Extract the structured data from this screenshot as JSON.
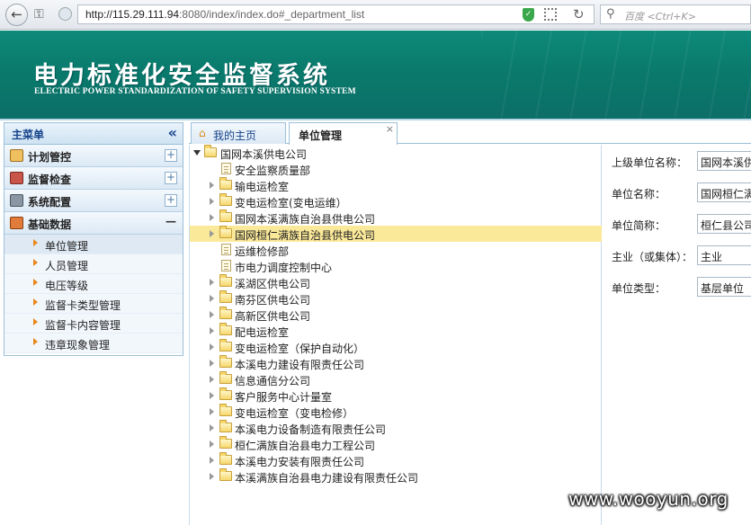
{
  "browser": {
    "url_host": "http://115.29.111.94",
    "url_rest": ":8080/index/index.do#_department_list",
    "search_placeholder": "百度 <Ctrl+K>"
  },
  "header": {
    "title": "电力标准化安全监督系统",
    "subtitle": "ELECTRIC POWER STANDARDIZATION OF SAFETY SUPERVISION SYSTEM"
  },
  "menu": {
    "title": "主菜单",
    "collapse_icon": "double-left-chevron-icon",
    "groups": [
      {
        "label": "计划管控",
        "icon": "clipboard-icon",
        "color": "#e8a33a"
      },
      {
        "label": "监督检查",
        "icon": "inspect-icon",
        "color": "#c0392b"
      },
      {
        "label": "系统配置",
        "icon": "config-icon",
        "color": "#7f8c8d"
      },
      {
        "label": "基础数据",
        "icon": "data-icon",
        "color": "#d35400"
      }
    ],
    "sub_items": [
      "单位管理",
      "人员管理",
      "电压等级",
      "监督卡类型管理",
      "监督卡内容管理",
      "违章现象管理"
    ]
  },
  "tabs": [
    {
      "label": "我的主页",
      "icon": "home-icon"
    },
    {
      "label": "单位管理",
      "close": "×"
    }
  ],
  "tree": {
    "root": "国网本溪供电公司",
    "nodes": [
      {
        "label": "安全监察质量部",
        "type": "doc"
      },
      {
        "label": "输电运检室",
        "type": "folder"
      },
      {
        "label": "变电运检室(变电运维）",
        "type": "folder"
      },
      {
        "label": "国网本溪满族自治县供电公司",
        "type": "folder"
      },
      {
        "label": "国网桓仁满族自治县供电公司",
        "type": "folder",
        "selected": true
      },
      {
        "label": "运维检修部",
        "type": "doc"
      },
      {
        "label": "市电力调度控制中心",
        "type": "doc"
      },
      {
        "label": "溪湖区供电公司",
        "type": "folder"
      },
      {
        "label": "南芬区供电公司",
        "type": "folder"
      },
      {
        "label": "高新区供电公司",
        "type": "folder"
      },
      {
        "label": "配电运检室",
        "type": "folder"
      },
      {
        "label": "变电运检室（保护自动化）",
        "type": "folder"
      },
      {
        "label": "本溪电力建设有限责任公司",
        "type": "folder"
      },
      {
        "label": "信息通信分公司",
        "type": "folder"
      },
      {
        "label": "客户服务中心计量室",
        "type": "folder"
      },
      {
        "label": "变电运检室（变电检修）",
        "type": "folder"
      },
      {
        "label": "本溪电力设备制造有限责任公司",
        "type": "folder"
      },
      {
        "label": "桓仁满族自治县电力工程公司",
        "type": "folder"
      },
      {
        "label": "本溪电力安装有限责任公司",
        "type": "folder"
      },
      {
        "label": "本溪满族自治县电力建设有限责任公司",
        "type": "folder"
      }
    ]
  },
  "form": {
    "fields": [
      {
        "label": "上级单位名称：",
        "value": "国网本溪供"
      },
      {
        "label": "单位名称：",
        "value": "国网桓仁满"
      },
      {
        "label": "单位简称：",
        "value": "桓仁县公司"
      },
      {
        "label": "主业（或集体）：",
        "value": "主业"
      },
      {
        "label": "单位类型：",
        "value": "基层单位"
      }
    ]
  },
  "watermark": "www.wooyun.org"
}
